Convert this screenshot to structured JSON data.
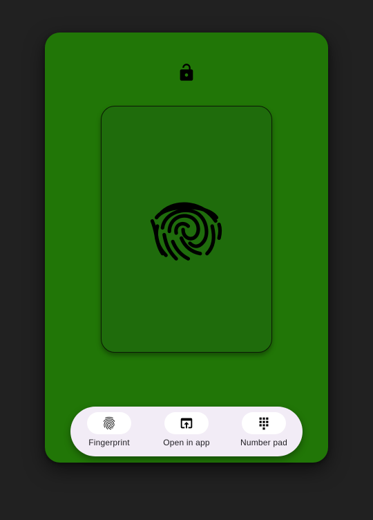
{
  "colors": {
    "page_background": "#212121",
    "card_background": "#217607",
    "sensor_background": "#1f6c0c",
    "bar_background": "#f2ecf6",
    "icon_color": "#000000"
  },
  "header": {
    "lock_state_icon": "lock-open-icon"
  },
  "sensor": {
    "icon": "fingerprint-icon"
  },
  "auth_modes": [
    {
      "label": "Fingerprint",
      "icon": "fingerprint-icon"
    },
    {
      "label": "Open in app",
      "icon": "open-in-app-icon"
    },
    {
      "label": "Number pad",
      "icon": "dialpad-icon"
    }
  ]
}
